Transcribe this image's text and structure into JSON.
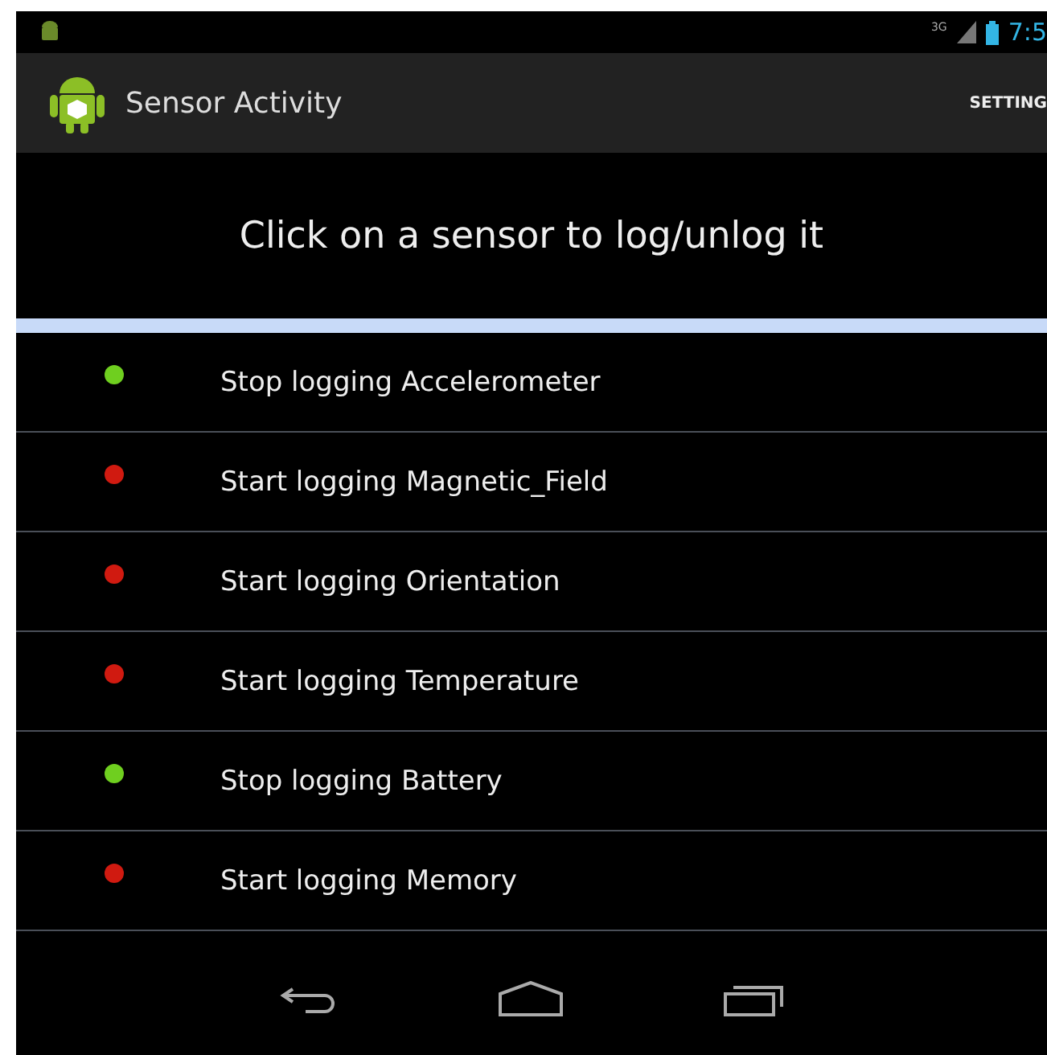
{
  "status_bar": {
    "network": "3G",
    "time": "7:5"
  },
  "action_bar": {
    "title": "Sensor Activity",
    "action": "SETTING"
  },
  "header": "Click on a sensor to log/unlog it",
  "sensors": [
    {
      "label": "Stop logging Accelerometer",
      "on": true
    },
    {
      "label": "Start logging Magnetic_Field",
      "on": false
    },
    {
      "label": "Start logging Orientation",
      "on": false
    },
    {
      "label": "Start logging Temperature",
      "on": false
    },
    {
      "label": "Stop logging Battery",
      "on": true
    },
    {
      "label": "Start logging Memory",
      "on": false
    }
  ]
}
